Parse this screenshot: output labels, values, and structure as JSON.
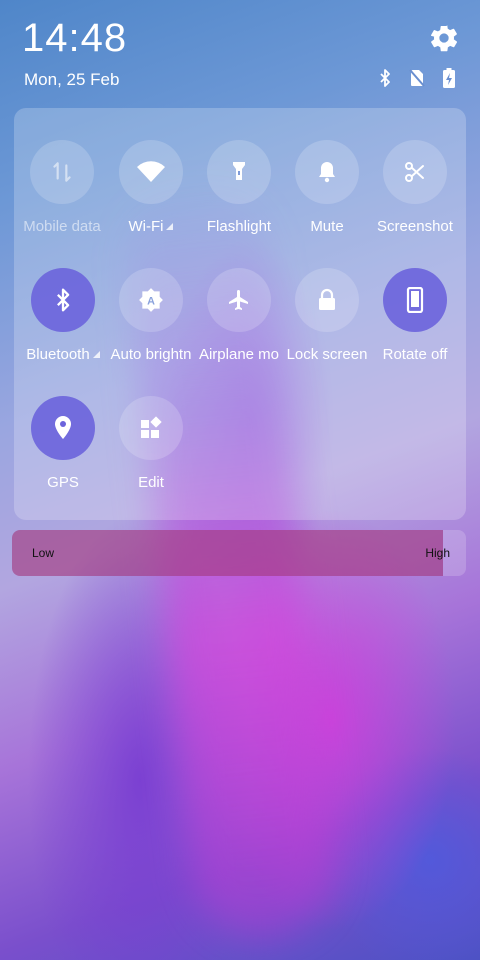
{
  "status": {
    "time": "14:48",
    "date": "Mon, 25 Feb",
    "icons": [
      "bluetooth-icon",
      "no-sim-icon",
      "battery-charging-icon"
    ]
  },
  "tiles": [
    {
      "label": "Mobile data",
      "icon": "mobile-data-icon",
      "state": "off"
    },
    {
      "label": "Wi-Fi",
      "icon": "wifi-icon",
      "state": "neutral"
    },
    {
      "label": "Flashlight",
      "icon": "flashlight-icon",
      "state": "neutral"
    },
    {
      "label": "Mute",
      "icon": "bell-icon",
      "state": "neutral"
    },
    {
      "label": "Screenshot",
      "icon": "scissors-icon",
      "state": "neutral"
    },
    {
      "label": "Bluetooth",
      "icon": "bluetooth-icon",
      "state": "on"
    },
    {
      "label": "Auto brightn",
      "icon": "auto-brightness-icon",
      "state": "neutral"
    },
    {
      "label": "Airplane mo",
      "icon": "airplane-icon",
      "state": "neutral"
    },
    {
      "label": "Lock screen",
      "icon": "lock-icon",
      "state": "neutral"
    },
    {
      "label": "Rotate off",
      "icon": "phone-rotate-icon",
      "state": "on"
    },
    {
      "label": "GPS",
      "icon": "location-pin-icon",
      "state": "on"
    },
    {
      "label": "Edit",
      "icon": "edit-grid-icon",
      "state": "neutral"
    }
  ],
  "brightness": {
    "low_label": "Low",
    "high_label": "High",
    "level": 0.95
  },
  "colors": {
    "active_tile": "#6c64dc",
    "panel": "rgba(255,255,255,0.22)",
    "brightness_fill": "#96206e"
  }
}
